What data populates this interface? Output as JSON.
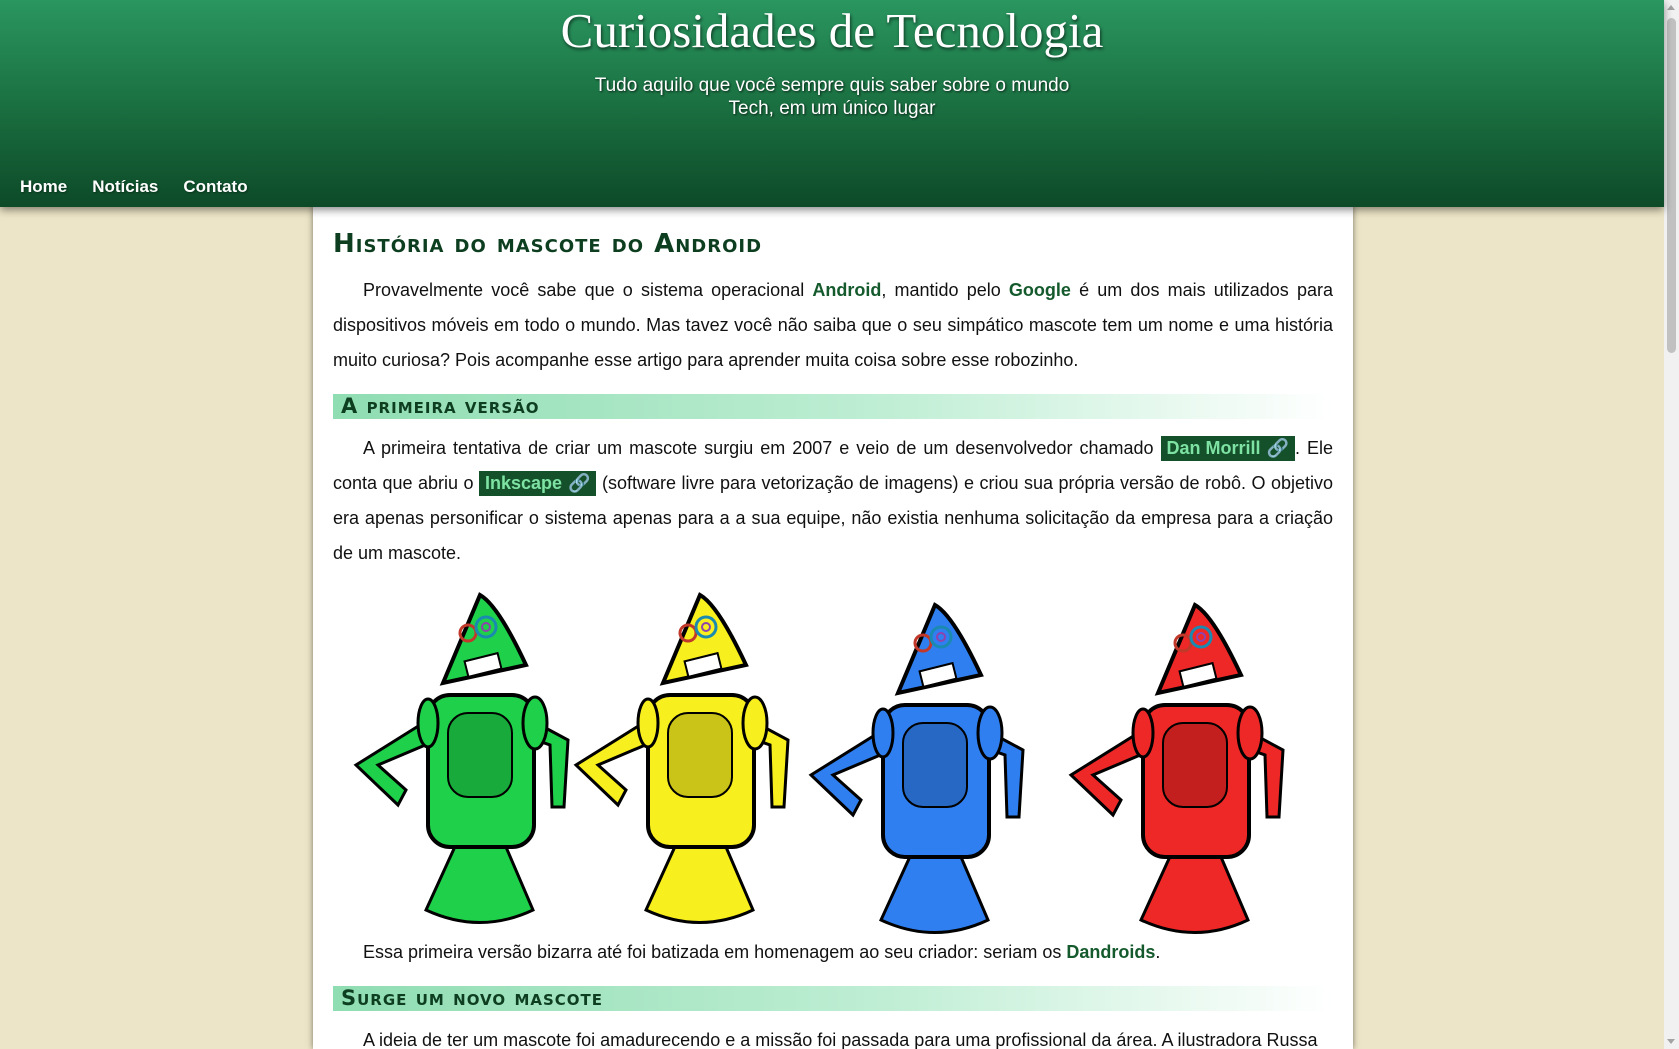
{
  "site": {
    "title": "Curiosidades de Tecnologia",
    "subtitle_line1": "Tudo aquilo que você sempre quis saber sobre o mundo",
    "subtitle_line2": "Tech, em um único lugar"
  },
  "nav": {
    "items": [
      {
        "label": "Home"
      },
      {
        "label": "Notícias"
      },
      {
        "label": "Contato"
      }
    ]
  },
  "article": {
    "title": "História do mascote do Android",
    "intro": {
      "t1": "Provavelmente você sabe que o sistema operacional ",
      "android": "Android",
      "t2": ", mantido pelo ",
      "google": "Google",
      "t3": " é um dos mais utilizados para dispositivos móveis em todo o mundo. Mas tavez você não saiba que o seu simpático mascote tem um nome e uma história muito curiosa? Pois acompanhe esse artigo para aprender muita coisa sobre esse robozinho."
    },
    "section1": {
      "heading": "A primeira versão",
      "t1": "A primeira tentativa de criar um mascote surgiu em 2007 e veio de um desenvolvedor chamado ",
      "link1": "Dan Morrill",
      "t2": ". Ele conta que abriu o ",
      "link2": "Inkscape",
      "t3": " (software livre para vetorização de imagens) e criou sua própria versão de robô. O objetivo era apenas personificar o sistema apenas para a a sua equipe, não existia nenhuma solicitação da empresa para a criação de um mascote.",
      "caption_t1": "Essa primeira versão bizarra até foi batizada em homenagem ao seu criador: seriam os ",
      "caption_name": "Dandroids",
      "caption_t2": "."
    },
    "section2": {
      "heading": "Surge um novo mascote",
      "t1": "A ideia de ter um mascote foi amadurecendo e a missão foi passada para uma profissional da área. A ilustradora Russa"
    }
  },
  "colors": {
    "header_top": "#2a9660",
    "header_bottom": "#0d4a28",
    "page_bg": "#ede5c7",
    "accent_dark": "#14502a",
    "link_text": "#7ee2a3",
    "robot_green": "#1fd04a",
    "robot_yellow": "#f8ef1e",
    "robot_blue": "#2f7ff0",
    "robot_red": "#ee2727"
  },
  "icons": [
    "link-chain-icon",
    "scroll-up-arrow-icon",
    "scroll-down-arrow-icon"
  ]
}
